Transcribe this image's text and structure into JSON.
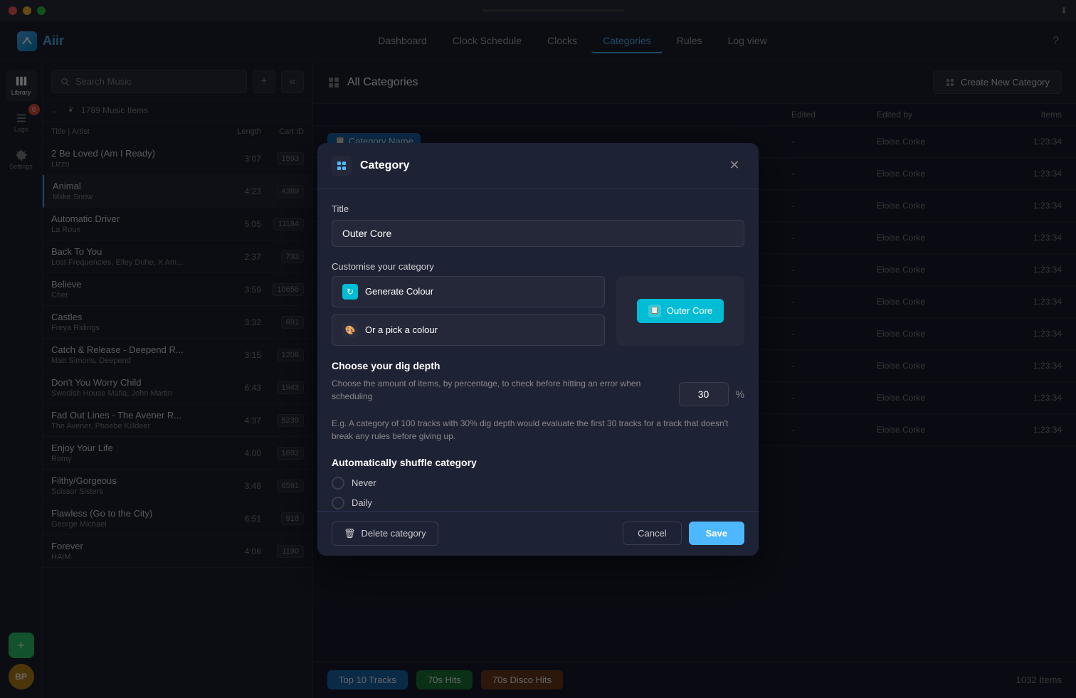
{
  "titlebar": {
    "traffic": [
      "red",
      "yellow",
      "green"
    ]
  },
  "nav": {
    "logo": "Aiir",
    "links": [
      "Dashboard",
      "Clock Schedule",
      "Clocks",
      "Categories",
      "Rules",
      "Log view"
    ],
    "active_link": "Categories"
  },
  "sidebar": {
    "items": [
      {
        "label": "Library",
        "icon": "library-icon"
      },
      {
        "label": "Logs",
        "icon": "logs-icon",
        "badge": "0"
      },
      {
        "label": "Settings",
        "icon": "settings-icon"
      }
    ],
    "avatar": "BP",
    "add_label": "+"
  },
  "music_panel": {
    "search_placeholder": "Search Music",
    "breadcrumb": "1789 Music Items",
    "columns": {
      "title": "Title | Artist",
      "length": "Length",
      "cart": "Cart ID"
    },
    "items": [
      {
        "title": "2 Be Loved (Am I Ready)",
        "artist": "Lizzo",
        "length": "3:07",
        "cart": "1593"
      },
      {
        "title": "Animal",
        "artist": "Miike Snow",
        "length": "4:23",
        "cart": "4389"
      },
      {
        "title": "Automatic Driver",
        "artist": "La Roux",
        "length": "5:05",
        "cart": "11184"
      },
      {
        "title": "Back To You",
        "artist": "Lost Frequencies, Elley Duhe, X Am...",
        "length": "2:37",
        "cart": "733"
      },
      {
        "title": "Believe",
        "artist": "Cher",
        "length": "3:59",
        "cart": "10656"
      },
      {
        "title": "Castles",
        "artist": "Freya Ridings",
        "length": "3:32",
        "cart": "691"
      },
      {
        "title": "Catch & Release - Deepend R...",
        "artist": "Matt Simons, Deepend",
        "length": "3:15",
        "cart": "1208"
      },
      {
        "title": "Don't You Worry Child",
        "artist": "Swedish House Mafia, John Martin",
        "length": "6:43",
        "cart": "1943"
      },
      {
        "title": "Fad Out Lines - The Avener R...",
        "artist": "The Avener, Phoebe Killdeer",
        "length": "4:37",
        "cart": "5239"
      },
      {
        "title": "Enjoy Your Life",
        "artist": "Romy",
        "length": "4:00",
        "cart": "1692"
      },
      {
        "title": "Filthy/Gorgeous",
        "artist": "Scissor Sisters",
        "length": "3:48",
        "cart": "6591"
      },
      {
        "title": "Flawless (Go to the City)",
        "artist": "George Michael",
        "length": "6:51",
        "cart": "918"
      },
      {
        "title": "Forever",
        "artist": "HAIM",
        "length": "4:06",
        "cart": "1190"
      }
    ]
  },
  "content": {
    "title": "All Categories",
    "create_btn": "Create New Category",
    "table": {
      "columns": {
        "name": "",
        "edited": "Edited",
        "edited_by": "Edited by",
        "items": "Items"
      },
      "rows": [
        {
          "name": "",
          "edited": "-",
          "edited_by": "Eloise Corke",
          "items": "1:23:34"
        },
        {
          "name": "",
          "edited": "-",
          "edited_by": "Eloise Corke",
          "items": "1:23:34"
        },
        {
          "name": "",
          "edited": "-",
          "edited_by": "Eloise Corke",
          "items": "1:23:34"
        },
        {
          "name": "",
          "edited": "-",
          "edited_by": "Eloise Corke",
          "items": "1:23:34"
        },
        {
          "name": "",
          "edited": "-",
          "edited_by": "Eloise Corke",
          "items": "1:23:34"
        },
        {
          "name": "",
          "edited": "-",
          "edited_by": "Eloise Corke",
          "items": "1:23:34"
        },
        {
          "name": "",
          "edited": "-",
          "edited_by": "Eloise Corke",
          "items": "1:23:34"
        },
        {
          "name": "",
          "edited": "-",
          "edited_by": "Eloise Corke",
          "items": "1:23:34"
        },
        {
          "name": "",
          "edited": "-",
          "edited_by": "Eloise Corke",
          "items": "1:23:34"
        },
        {
          "name": "",
          "edited": "-",
          "edited_by": "Eloise Corke",
          "items": "1:23:34"
        }
      ]
    }
  },
  "bottom_bar": {
    "categories": [
      {
        "label": "Top 10 Tracks",
        "color": "blue"
      },
      {
        "label": "70s Hits",
        "color": "green"
      },
      {
        "label": "70s Disco Hits",
        "color": "purple"
      }
    ],
    "items_count": "1032 Items"
  },
  "modal": {
    "title": "Category",
    "form": {
      "title_label": "Title",
      "title_value": "Outer Core",
      "customise_label": "Customise your category",
      "gen_colour_label": "Generate Colour",
      "pick_colour_label": "Or a pick a colour",
      "preview_text": "Outer Core",
      "dig_depth_header": "Choose your dig depth",
      "dig_depth_desc": "Choose the amount of items, by percentage, to check before hitting an error when scheduling",
      "dig_depth_value": "30",
      "dig_depth_unit": "%",
      "dig_depth_example": "E.g. A category of 100 tracks with 30% dig depth would evaluate the first 30 tracks for a track that doesn't break any rules before giving up.",
      "shuffle_header": "Automatically shuffle category",
      "shuffle_options": [
        "Never",
        "Daily"
      ],
      "delete_label": "Delete category",
      "cancel_label": "Cancel",
      "save_label": "Save"
    }
  }
}
